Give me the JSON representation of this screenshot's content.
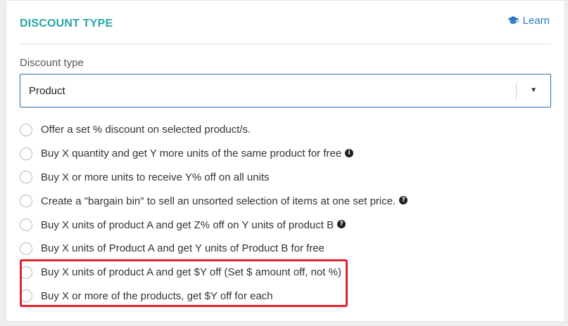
{
  "section": {
    "title": "DISCOUNT TYPE",
    "learn_label": "Learn"
  },
  "field": {
    "label": "Discount type",
    "selected_value": "Product"
  },
  "options": [
    {
      "label": "Offer a set % discount on selected product/s.",
      "icon": null
    },
    {
      "label": "Buy X quantity and get Y more units of the same product for free",
      "icon": "info-icon",
      "icon_glyph": "i"
    },
    {
      "label": "Buy X or more units to receive Y% off on all units",
      "icon": null
    },
    {
      "label": "Create a \"bargain bin\" to sell an unsorted selection of items at one set price.",
      "icon": "question-icon",
      "icon_glyph": "?"
    },
    {
      "label": "Buy X units of product A and get Z% off on Y units of product B",
      "icon": "question-icon",
      "icon_glyph": "?"
    },
    {
      "label": "Buy X units of Product A and get Y units of Product B for free",
      "icon": null
    },
    {
      "label": "Buy X units of product A and get $Y off (Set $ amount off, not %)",
      "icon": null
    },
    {
      "label": "Buy X or more of the products, get $Y off for each",
      "icon": null
    }
  ],
  "colors": {
    "title": "#2aa5a8",
    "link": "#2d79c0",
    "select_border": "#2d6fa8",
    "highlight": "#e0222e"
  }
}
